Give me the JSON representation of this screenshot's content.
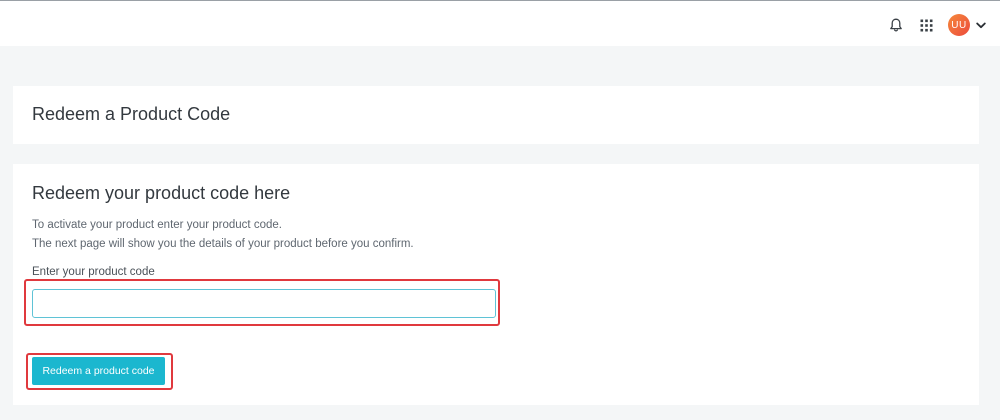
{
  "header": {
    "avatar_initials": "UU",
    "icons": {
      "notifications": "bell-icon",
      "apps": "grid-icon",
      "menu": "chevron-down-icon"
    }
  },
  "title_card": {
    "title": "Redeem a Product Code"
  },
  "form_card": {
    "heading": "Redeem your product code here",
    "description_line1": "To activate your product enter your product code.",
    "description_line2": "The next page will show you the details of your product before you confirm.",
    "field_label": "Enter your product code",
    "field_value": "",
    "button_label": "Redeem a product code"
  },
  "colors": {
    "accent": "#1bb7cf",
    "highlight": "#e0393e",
    "avatar_start": "#f5893b",
    "avatar_end": "#ec4a3c",
    "page_bg": "#f4f6f7"
  }
}
